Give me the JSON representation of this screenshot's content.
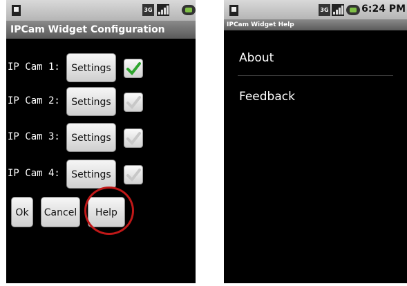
{
  "config_screen": {
    "title": "IPCam Widget Configuration",
    "status_3g": "3G",
    "cameras": [
      {
        "label": "IP Cam 1:",
        "button": "Settings",
        "checked": true
      },
      {
        "label": "IP Cam 2:",
        "button": "Settings",
        "checked": false
      },
      {
        "label": "IP Cam 3:",
        "button": "Settings",
        "checked": false
      },
      {
        "label": "IP Cam 4:",
        "button": "Settings",
        "checked": false
      }
    ],
    "buttons": {
      "ok": "Ok",
      "cancel": "Cancel",
      "help": "Help"
    },
    "highlight_color": "#c01818",
    "check_color": "#2fa52f"
  },
  "help_screen": {
    "status_3g": "3G",
    "time": "6:24 PM",
    "title": "IPCam Widget Help",
    "items": [
      "About",
      "Feedback"
    ]
  }
}
